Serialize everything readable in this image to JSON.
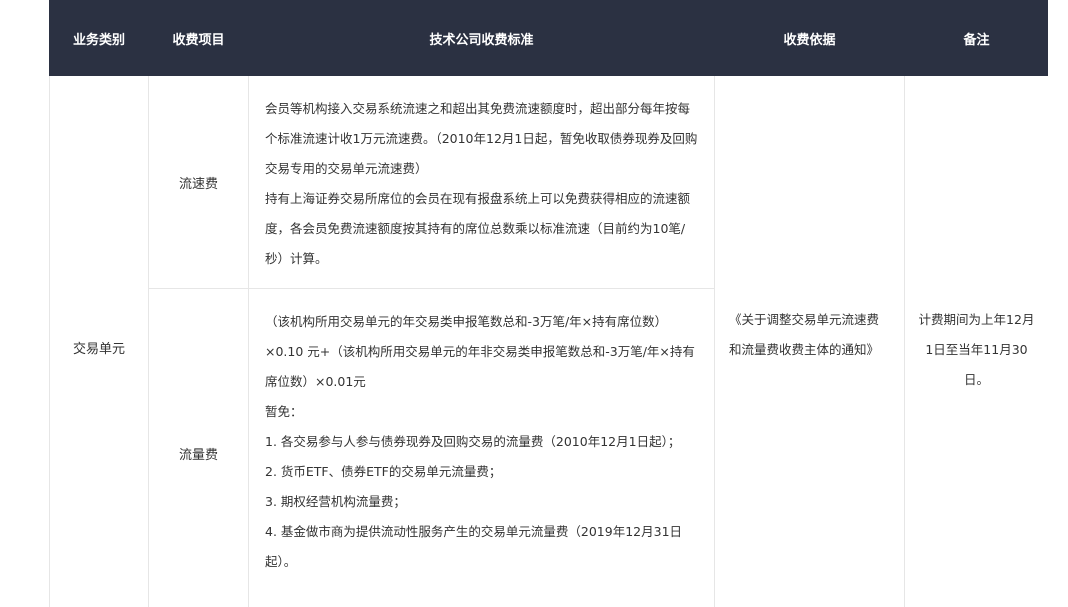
{
  "table": {
    "headers": [
      "业务类别",
      "收费项目",
      "技术公司收费标准",
      "收费依据",
      "备注"
    ],
    "category": "交易单元",
    "rows": [
      {
        "item": "流速费",
        "standard_lines": [
          "会员等机构接入交易系统流速之和超出其免费流速额度时，超出部分每年按每个标准流速计收1万元流速费。（2010年12月1日起，暂免收取债券现券及回购交易专用的交易单元流速费）",
          "持有上海证券交易所席位的会员在现有报盘系统上可以免费获得相应的流速额度，各会员免费流速额度按其持有的席位总数乘以标准流速（目前约为10笔/秒）计算。"
        ]
      },
      {
        "item": "流量费",
        "standard_lines": [
          "（该机构所用交易单元的年交易类申报笔数总和-3万笔/年×持有席位数）×0.10 元+（该机构所用交易单元的年非交易类申报笔数总和-3万笔/年×持有席位数）×0.01元",
          "暂免：",
          "1. 各交易参与人参与债券现券及回购交易的流量费（2010年12月1日起）；",
          "2. 货币ETF、债券ETF的交易单元流量费；",
          "3. 期权经营机构流量费；",
          "4. 基金做市商为提供流动性服务产生的交易单元流量费（2019年12月31日起）。"
        ]
      }
    ],
    "basis": "《关于调整交易单元流速费和流量费收费主体的通知》",
    "remark": "计费期间为上年12月1日至当年11月30日。"
  }
}
